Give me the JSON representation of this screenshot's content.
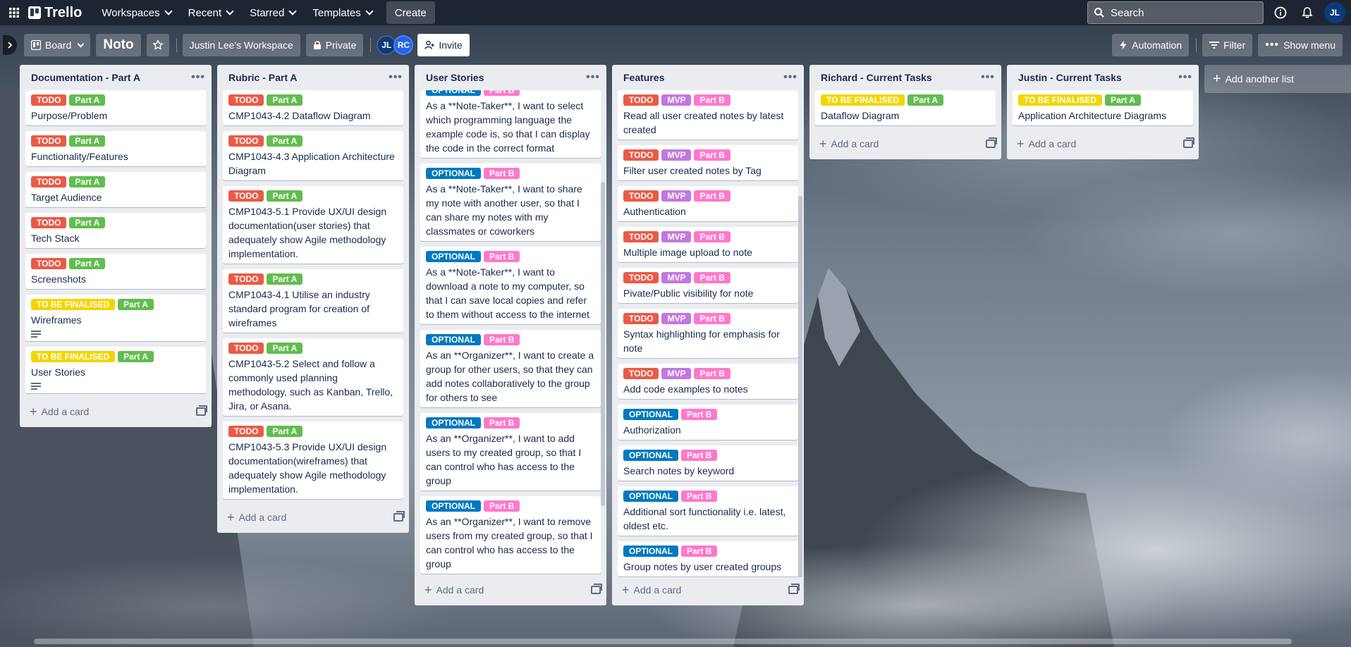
{
  "nav": {
    "brand": "Trello",
    "menu": [
      "Workspaces",
      "Recent",
      "Starred",
      "Templates"
    ],
    "create": "Create",
    "search_placeholder": "Search",
    "user_initials": "JL"
  },
  "board": {
    "view": "Board",
    "name": "Noto",
    "workspace": "Justin Lee's Workspace",
    "visibility": "Private",
    "members": [
      "JL",
      "RC"
    ],
    "invite": "Invite",
    "automation": "Automation",
    "filter": "Filter",
    "show_menu": "Show menu"
  },
  "labels": {
    "todo": "TODO",
    "final": "TO BE FINALISED",
    "parta": "Part A",
    "partb": "Part B",
    "mvp": "MVP",
    "optional": "OPTIONAL"
  },
  "add_card": "Add a card",
  "add_list": "Add another list",
  "lists": [
    {
      "title": "Documentation - Part A",
      "cards": [
        {
          "labels": [
            "todo",
            "parta"
          ],
          "text": "Purpose/Problem"
        },
        {
          "labels": [
            "todo",
            "parta"
          ],
          "text": "Functionality/Features"
        },
        {
          "labels": [
            "todo",
            "parta"
          ],
          "text": "Target Audience"
        },
        {
          "labels": [
            "todo",
            "parta"
          ],
          "text": "Tech Stack"
        },
        {
          "labels": [
            "todo",
            "parta"
          ],
          "text": "Screenshots"
        },
        {
          "labels": [
            "final",
            "parta"
          ],
          "text": "Wireframes",
          "desc": true
        },
        {
          "labels": [
            "final",
            "parta"
          ],
          "text": "User Stories",
          "desc": true
        }
      ]
    },
    {
      "title": "Rubric - Part A",
      "cards": [
        {
          "labels": [
            "todo",
            "parta"
          ],
          "text": "CMP1043-4.2 Dataflow Diagram"
        },
        {
          "labels": [
            "todo",
            "parta"
          ],
          "text": "CMP1043-4.3 Application Architecture Diagram"
        },
        {
          "labels": [
            "todo",
            "parta"
          ],
          "text": "CMP1043-5.1 Provide UX/UI design documentation(user stories) that adequately show Agile methodology implementation."
        },
        {
          "labels": [
            "todo",
            "parta"
          ],
          "text": "CMP1043-4.1 Utilise an industry standard program for creation of wireframes"
        },
        {
          "labels": [
            "todo",
            "parta"
          ],
          "text": "CMP1043-5.2 Select and follow a commonly used planning methodology, such as Kanban, Trello, Jira, or Asana."
        },
        {
          "labels": [
            "todo",
            "parta"
          ],
          "text": "CMP1043-5.3 Provide UX/UI design documentation(wireframes) that adequately show Agile methodology implementation."
        }
      ]
    },
    {
      "title": "User Stories",
      "cards": [
        {
          "labels": [
            "optional",
            "partb"
          ],
          "text": "As a **Note-Taker**, I want to select which programming language the example code is, so that I can display the code in the correct format"
        },
        {
          "labels": [
            "optional",
            "partb"
          ],
          "text": "As a **Note-Taker**, I want to share my note with another user, so that I can share my notes with my classmates or coworkers"
        },
        {
          "labels": [
            "optional",
            "partb"
          ],
          "text": "As a **Note-Taker**, I want to download a note to my computer, so that I can save local copies and refer to them without access to the internet"
        },
        {
          "labels": [
            "optional",
            "partb"
          ],
          "text": "As an **Organizer**, I want to create a group for other users, so that they can add notes collaboratively to the group for others to see"
        },
        {
          "labels": [
            "optional",
            "partb"
          ],
          "text": "As an **Organizer**, I want to add users to my created group, so that I can control who has access to the group"
        },
        {
          "labels": [
            "optional",
            "partb"
          ],
          "text": "As an **Organizer**, I want to remove users from my created group, so that I can control who has access to the group"
        }
      ]
    },
    {
      "title": "Features",
      "cards": [
        {
          "labels": [
            "todo",
            "mvp",
            "partb"
          ],
          "text": "Read all user created notes by latest created"
        },
        {
          "labels": [
            "todo",
            "mvp",
            "partb"
          ],
          "text": "Filter user created notes by Tag"
        },
        {
          "labels": [
            "todo",
            "mvp",
            "partb"
          ],
          "text": "Authentication"
        },
        {
          "labels": [
            "todo",
            "mvp",
            "partb"
          ],
          "text": "Multiple image upload to note"
        },
        {
          "labels": [
            "todo",
            "mvp",
            "partb"
          ],
          "text": "Pivate/Public visibility for note"
        },
        {
          "labels": [
            "todo",
            "mvp",
            "partb"
          ],
          "text": "Syntax highlighting for emphasis for note"
        },
        {
          "labels": [
            "todo",
            "mvp",
            "partb"
          ],
          "text": "Add code examples to notes"
        },
        {
          "labels": [
            "optional",
            "partb"
          ],
          "text": "Authorization"
        },
        {
          "labels": [
            "optional",
            "partb"
          ],
          "text": "Search notes by keyword"
        },
        {
          "labels": [
            "optional",
            "partb"
          ],
          "text": "Additional sort functionality i.e. latest, oldest etc."
        },
        {
          "labels": [
            "optional",
            "partb"
          ],
          "text": "Group notes by user created groups"
        }
      ]
    },
    {
      "title": "Richard - Current Tasks",
      "cards": [
        {
          "labels": [
            "final",
            "parta"
          ],
          "text": "Dataflow Diagram"
        }
      ]
    },
    {
      "title": "Justin - Current Tasks",
      "cards": [
        {
          "labels": [
            "final",
            "parta"
          ],
          "text": "Application Architecture Diagrams"
        }
      ]
    }
  ]
}
